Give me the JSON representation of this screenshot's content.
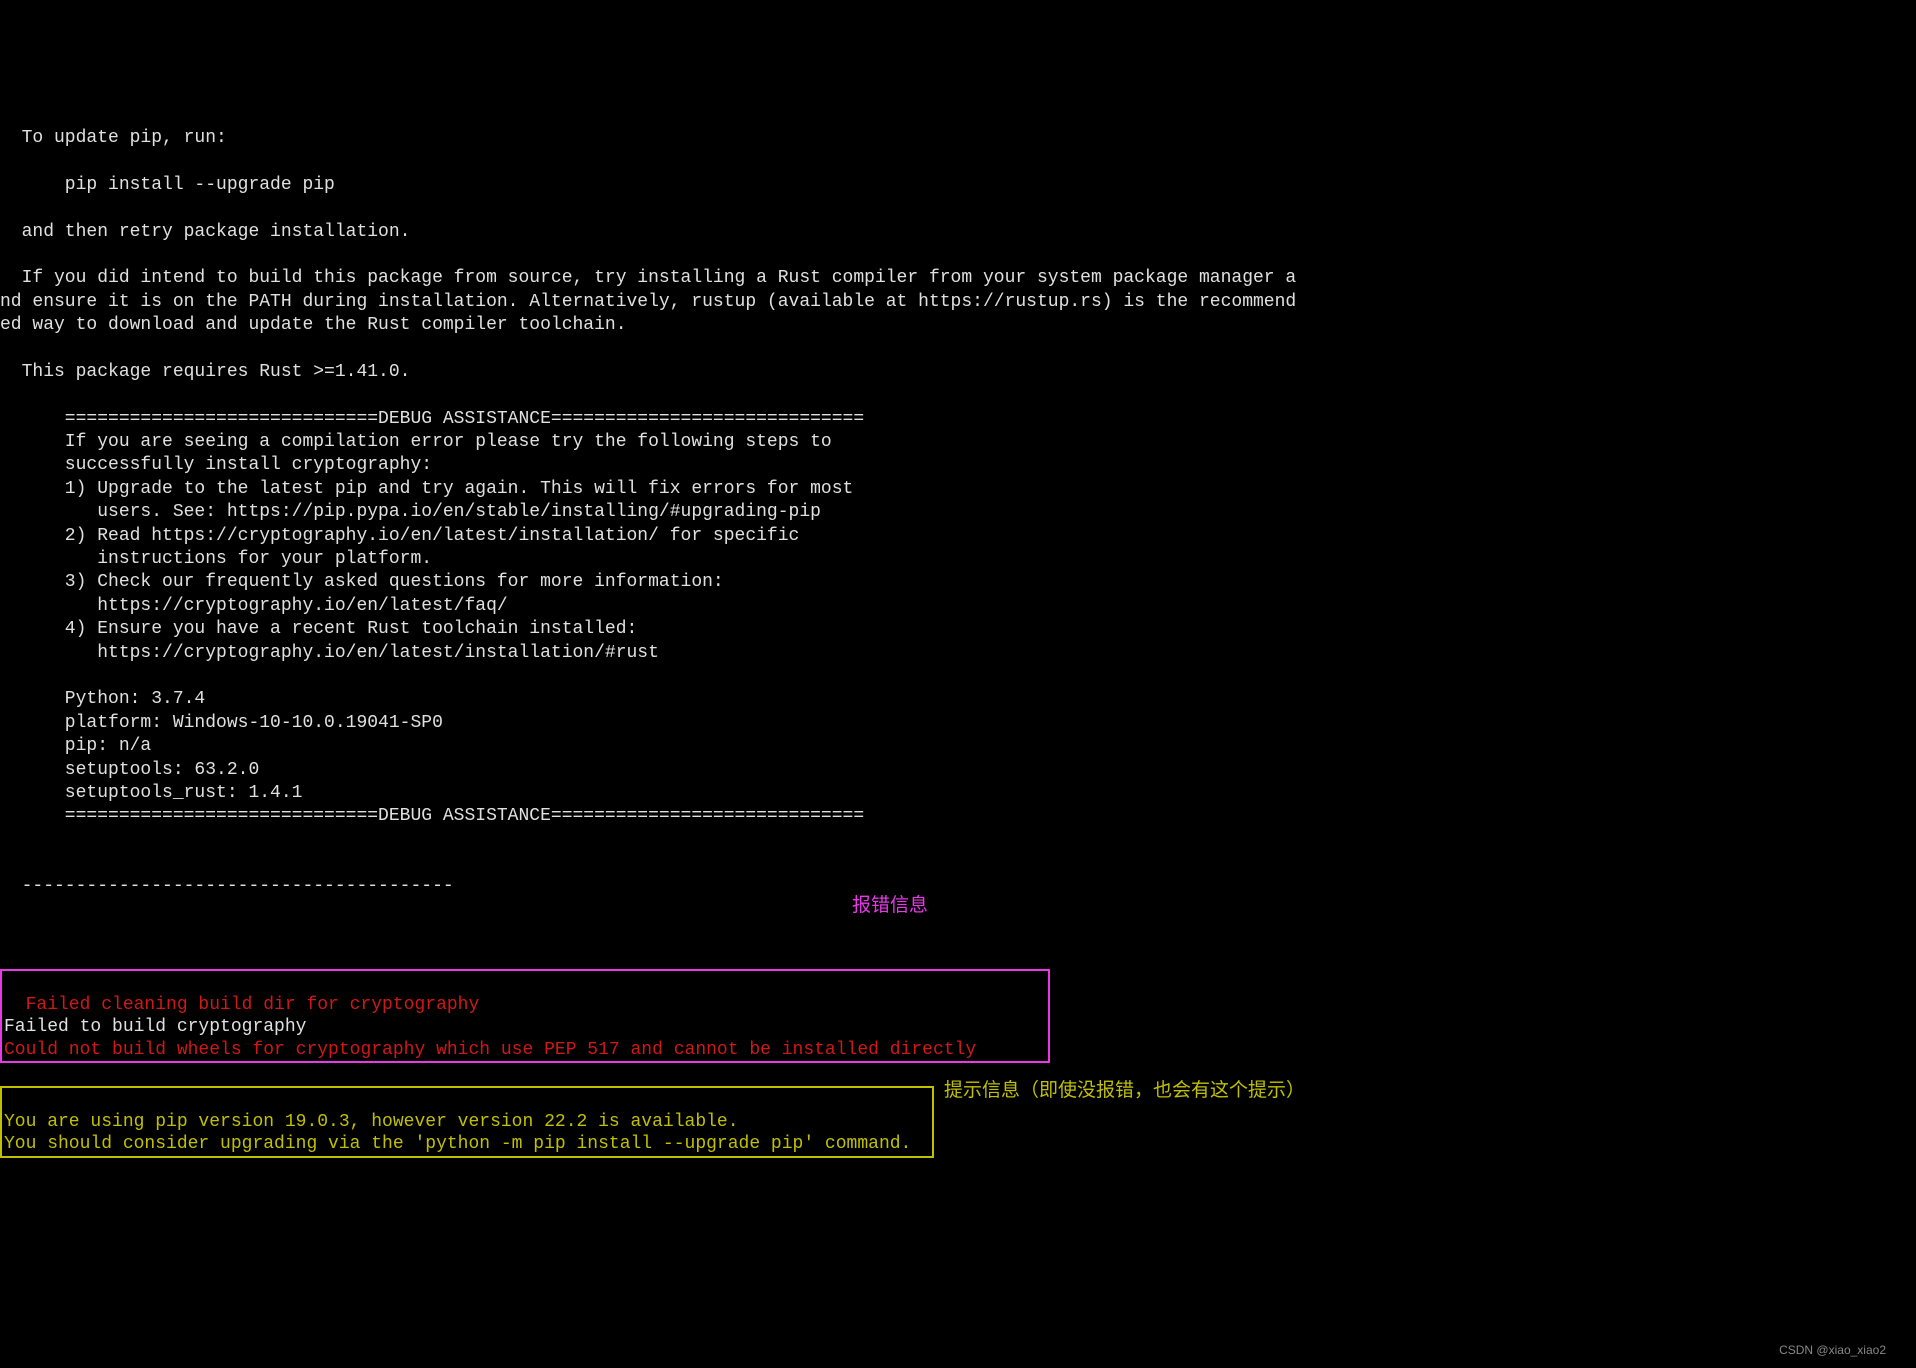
{
  "terminal": {
    "line1": "  To update pip, run:",
    "line2": "",
    "line3": "      pip install --upgrade pip",
    "line4": "",
    "line5": "  and then retry package installation.",
    "line6": "",
    "line7": "  If you did intend to build this package from source, try installing a Rust compiler from your system package manager a",
    "line8": "nd ensure it is on the PATH during installation. Alternatively, rustup (available at https://rustup.rs) is the recommend",
    "line9": "ed way to download and update the Rust compiler toolchain.",
    "line10": "",
    "line11": "  This package requires Rust >=1.41.0.",
    "line12": "",
    "line13": "      =============================DEBUG ASSISTANCE=============================",
    "line14": "      If you are seeing a compilation error please try the following steps to",
    "line15": "      successfully install cryptography:",
    "line16": "      1) Upgrade to the latest pip and try again. This will fix errors for most",
    "line17": "         users. See: https://pip.pypa.io/en/stable/installing/#upgrading-pip",
    "line18": "      2) Read https://cryptography.io/en/latest/installation/ for specific",
    "line19": "         instructions for your platform.",
    "line20": "      3) Check our frequently asked questions for more information:",
    "line21": "         https://cryptography.io/en/latest/faq/",
    "line22": "      4) Ensure you have a recent Rust toolchain installed:",
    "line23": "         https://cryptography.io/en/latest/installation/#rust",
    "line24": "",
    "line25": "      Python: 3.7.4",
    "line26": "      platform: Windows-10-10.0.19041-SP0",
    "line27": "      pip: n/a",
    "line28": "      setuptools: 63.2.0",
    "line29": "      setuptools_rust: 1.4.1",
    "line30": "      =============================DEBUG ASSISTANCE=============================",
    "line31": "",
    "line32": "",
    "line33": "  ----------------------------------------"
  },
  "error_box": {
    "line1": "  Failed cleaning build dir for cryptography",
    "line2": "Failed to build cryptography",
    "line3": "Could not build wheels for cryptography which use PEP 517 and cannot be installed directly"
  },
  "hint_box": {
    "line1": "You are using pip version 19.0.3, however version 22.2 is available.",
    "line2": "You should consider upgrading via the 'python -m pip install --upgrade pip' command."
  },
  "annotations": {
    "error_label": "报错信息",
    "hint_label": "提示信息（即使没报错，也会有这个提示）"
  },
  "watermark": "CSDN @xiao_xiao2"
}
